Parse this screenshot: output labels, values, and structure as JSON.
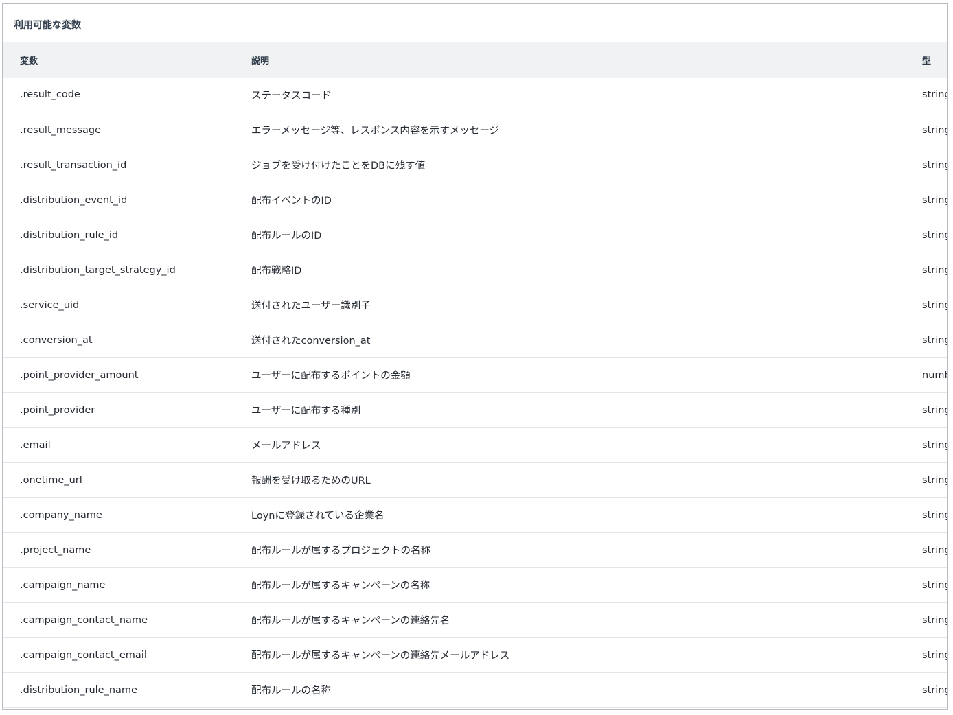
{
  "panel": {
    "title": "利用可能な変数"
  },
  "table": {
    "headers": {
      "variable": "変数",
      "description": "説明",
      "type": "型"
    },
    "rows": [
      {
        "variable": ".result_code",
        "description": "ステータスコード",
        "type": "string"
      },
      {
        "variable": ".result_message",
        "description": "エラーメッセージ等、レスポンス内容を示すメッセージ",
        "type": "string"
      },
      {
        "variable": ".result_transaction_id",
        "description": "ジョブを受け付けたことをDBに残す値",
        "type": "string"
      },
      {
        "variable": ".distribution_event_id",
        "description": "配布イベントのID",
        "type": "string"
      },
      {
        "variable": ".distribution_rule_id",
        "description": "配布ルールのID",
        "type": "string"
      },
      {
        "variable": ".distribution_target_strategy_id",
        "description": "配布戦略ID",
        "type": "string"
      },
      {
        "variable": ".service_uid",
        "description": "送付されたユーザー識別子",
        "type": "string"
      },
      {
        "variable": ".conversion_at",
        "description": "送付されたconversion_at",
        "type": "string"
      },
      {
        "variable": ".point_provider_amount",
        "description": "ユーザーに配布するポイントの金額",
        "type": "number"
      },
      {
        "variable": ".point_provider",
        "description": "ユーザーに配布する種別",
        "type": "string"
      },
      {
        "variable": ".email",
        "description": "メールアドレス",
        "type": "string"
      },
      {
        "variable": ".onetime_url",
        "description": "報酬を受け取るためのURL",
        "type": "string"
      },
      {
        "variable": ".company_name",
        "description": "Loynに登録されている企業名",
        "type": "string"
      },
      {
        "variable": ".project_name",
        "description": "配布ルールが属するプロジェクトの名称",
        "type": "string"
      },
      {
        "variable": ".campaign_name",
        "description": "配布ルールが属するキャンペーンの名称",
        "type": "string"
      },
      {
        "variable": ".campaign_contact_name",
        "description": "配布ルールが属するキャンペーンの連絡先名",
        "type": "string"
      },
      {
        "variable": ".campaign_contact_email",
        "description": "配布ルールが属するキャンペーンの連絡先メールアドレス",
        "type": "string"
      },
      {
        "variable": ".distribution_rule_name",
        "description": "配布ルールの名称",
        "type": "string"
      }
    ]
  }
}
